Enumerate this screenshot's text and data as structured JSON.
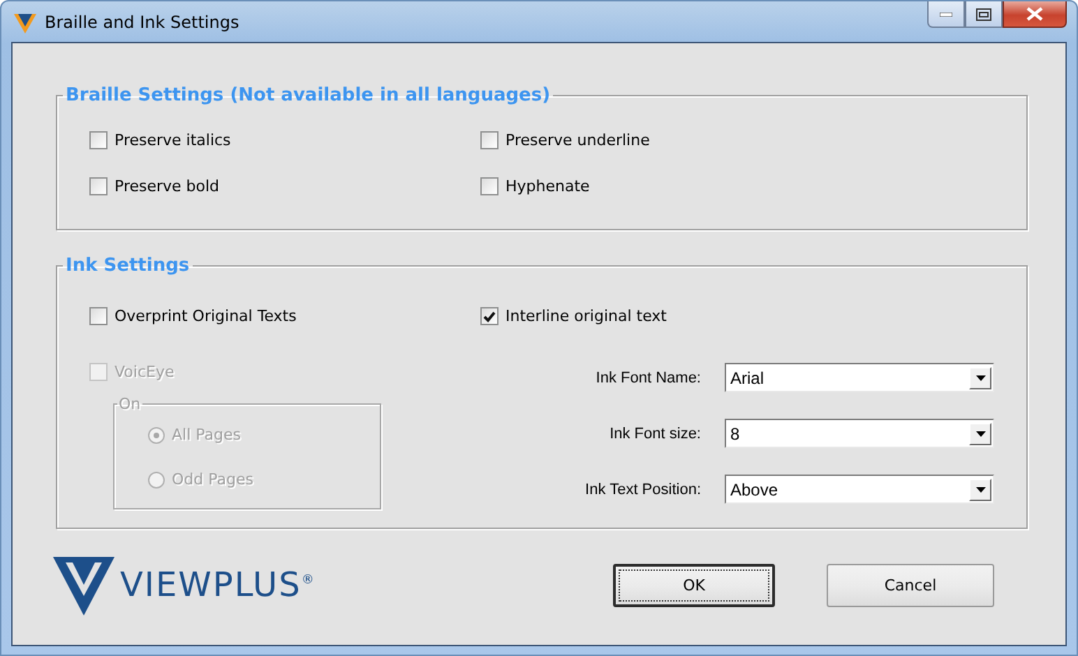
{
  "window": {
    "title": "Braille and Ink Settings"
  },
  "braille_settings": {
    "title": "Braille Settings (Not available in all languages)",
    "checkboxes": [
      {
        "label": "Preserve italics",
        "checked": false
      },
      {
        "label": "Preserve underline",
        "checked": false
      },
      {
        "label": "Preserve bold",
        "checked": false
      },
      {
        "label": "Hyphenate",
        "checked": false
      }
    ]
  },
  "ink_settings": {
    "title": "Ink Settings",
    "overprint": {
      "label": "Overprint Original Texts",
      "checked": false,
      "disabled": false
    },
    "interline": {
      "label": "Interline original text",
      "checked": true,
      "disabled": false
    },
    "voiceeye": {
      "label": "VoicEye",
      "checked": false,
      "disabled": true
    },
    "pages_group": {
      "title": "On",
      "disabled": true,
      "options": [
        {
          "label": "All Pages",
          "selected": true
        },
        {
          "label": "Odd Pages",
          "selected": false
        }
      ]
    },
    "fields": [
      {
        "label": "Ink Font Name:",
        "value": "Arial"
      },
      {
        "label": "Ink Font size:",
        "value": "8"
      },
      {
        "label": "Ink Text Position:",
        "value": "Above"
      }
    ]
  },
  "logo": {
    "text": "VIEWPLUS$^{®}$"
  },
  "buttons": [
    {
      "label": "OK",
      "default": true
    },
    {
      "label": "Cancel",
      "default": false
    }
  ]
}
